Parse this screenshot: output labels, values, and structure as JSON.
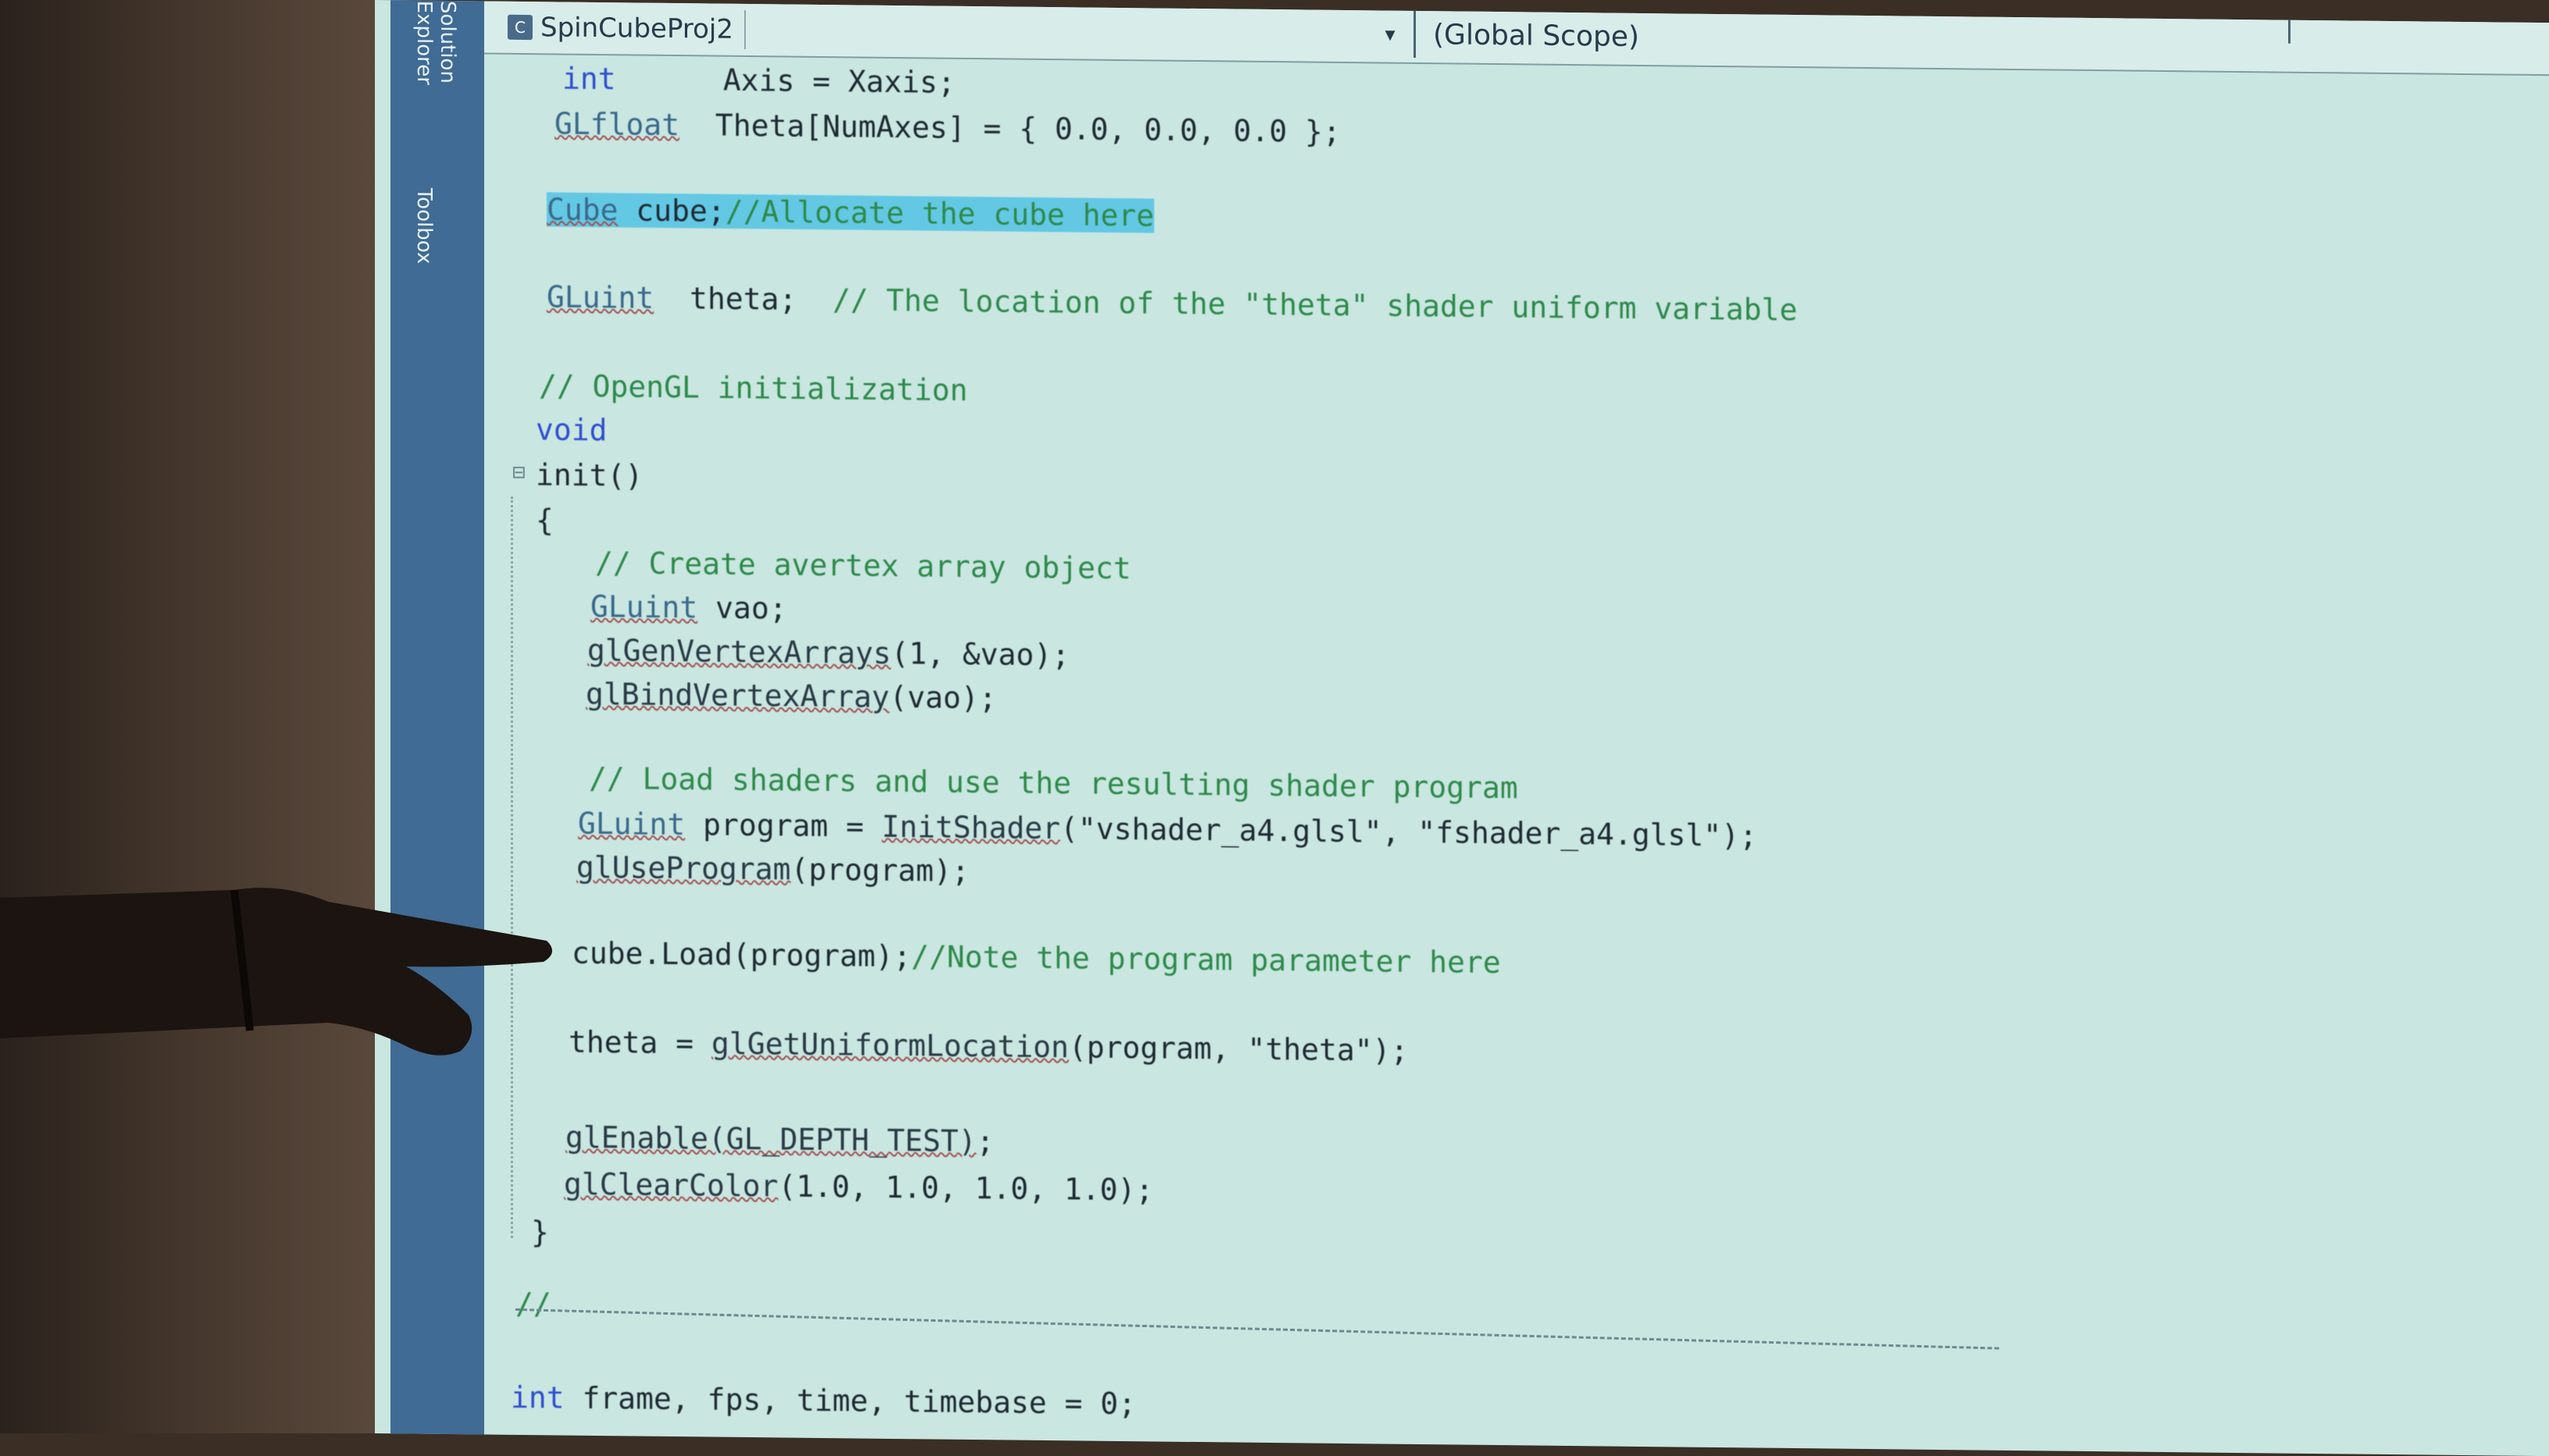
{
  "side_tabs": [
    "Solution Explorer",
    "Toolbox"
  ],
  "header": {
    "file_tab": "SpinCubeProj2",
    "scope": "(Global Scope)"
  },
  "code": {
    "l1_kw": "int",
    "l1_rest": "      Axis = Xaxis;",
    "l2_type": "GLfloat",
    "l2_rest": "  Theta[NumAxes] = { 0.0, 0.0, 0.0 };",
    "l3_type": "Cube",
    "l3_ident": " cube;",
    "l3_cm": "//Allocate the cube here",
    "l4_type": "GLuint",
    "l4_rest": "  theta;  ",
    "l4_cm": "// The location of the \"theta\" shader uniform variable",
    "l5_cm": "// OpenGL initialization",
    "l6_kw": "void",
    "l7": "init()",
    "l8": "{",
    "l9_cm": "// Create avertex array object",
    "l10_type": "GLuint",
    "l10_rest": " vao;",
    "l11_fn": "glGenVertexArrays",
    "l11_rest": "(1, &vao);",
    "l12_fn": "glBindVertexArray",
    "l12_rest": "(vao);",
    "l13_cm": "// Load shaders and use the resulting shader program",
    "l14_type": "GLuint",
    "l14_mid": " program = ",
    "l14_fn": "InitShader",
    "l14_rest": "(\"vshader_a4.glsl\", \"fshader_a4.glsl\");",
    "l15_fn": "glUseProgram",
    "l15_rest": "(program);",
    "l16": "cube.Load(program);",
    "l16_cm": "//Note the program parameter here",
    "l17_a": "theta = ",
    "l17_fn": "glGetUniformLocation",
    "l17_rest": "(program, \"theta\");",
    "l18_fn": "glEnable(GL_DEPTH_TEST)",
    "l18_rest": ";",
    "l19_fn": "glClearColor",
    "l19_rest": "(1.0, 1.0, 1.0, 1.0);",
    "l20": "}",
    "l21_cm": "//",
    "l22_kw": "int",
    "l22_rest": " frame, fps, time, timebase = 0;"
  }
}
